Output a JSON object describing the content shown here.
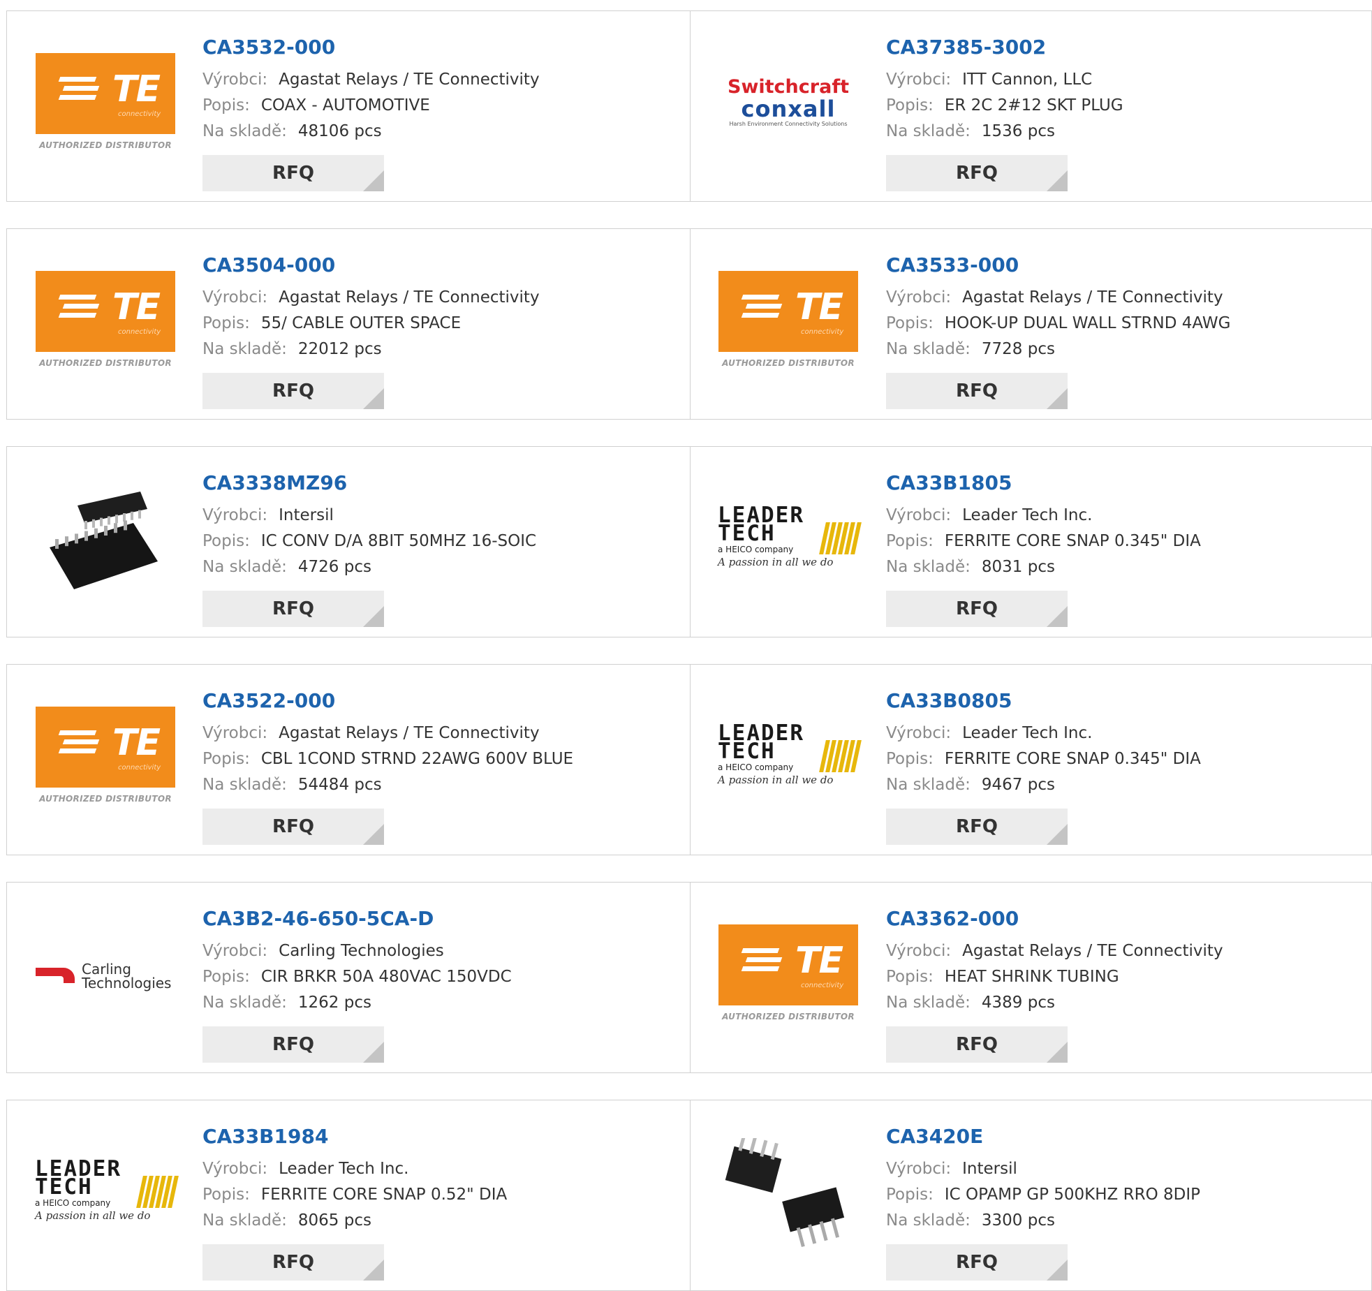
{
  "labels": {
    "manufacturer": "Výrobci:",
    "description": "Popis:",
    "stock": "Na skladě:",
    "rfq": "RFQ"
  },
  "logo_text": {
    "te": "TE",
    "te_sub": "connectivity",
    "te_auth": "AUTHORIZED DISTRIBUTOR",
    "switchcraft": "Switchcraft",
    "conxall": "conxall",
    "switch_tag": "Harsh Environment Connectivity Solutions",
    "leader": "LEADER",
    "tech": "TECH",
    "heico": "a HEICO company",
    "passion": "A passion in all we do",
    "carling1": "Carling",
    "carling2": "Technologies"
  },
  "products": [
    {
      "part": "CA3532-000",
      "manufacturer": "Agastat Relays / TE Connectivity",
      "description": "COAX - AUTOMOTIVE",
      "stock": "48106 pcs",
      "logo": "te"
    },
    {
      "part": "CA37385-3002",
      "manufacturer": "ITT Cannon, LLC",
      "description": "ER 2C 2#12 SKT PLUG",
      "stock": "1536 pcs",
      "logo": "switchcraft"
    },
    {
      "part": "CA3504-000",
      "manufacturer": "Agastat Relays / TE Connectivity",
      "description": "55/ CABLE OUTER SPACE",
      "stock": "22012 pcs",
      "logo": "te"
    },
    {
      "part": "CA3533-000",
      "manufacturer": "Agastat Relays / TE Connectivity",
      "description": "HOOK-UP DUAL WALL STRND 4AWG",
      "stock": "7728 pcs",
      "logo": "te"
    },
    {
      "part": "CA3338MZ96",
      "manufacturer": "Intersil",
      "description": "IC CONV D/A 8BIT 50MHZ 16-SOIC",
      "stock": "4726 pcs",
      "logo": "soic"
    },
    {
      "part": "CA33B1805",
      "manufacturer": "Leader Tech Inc.",
      "description": "FERRITE CORE SNAP 0.345\" DIA",
      "stock": "8031 pcs",
      "logo": "leader"
    },
    {
      "part": "CA3522-000",
      "manufacturer": "Agastat Relays / TE Connectivity",
      "description": "CBL 1COND STRND 22AWG 600V BLUE",
      "stock": "54484 pcs",
      "logo": "te"
    },
    {
      "part": "CA33B0805",
      "manufacturer": "Leader Tech Inc.",
      "description": "FERRITE CORE SNAP 0.345\" DIA",
      "stock": "9467 pcs",
      "logo": "leader"
    },
    {
      "part": "CA3B2-46-650-5CA-D",
      "manufacturer": "Carling Technologies",
      "description": "CIR BRKR 50A 480VAC 150VDC",
      "stock": "1262 pcs",
      "logo": "carling"
    },
    {
      "part": "CA3362-000",
      "manufacturer": "Agastat Relays / TE Connectivity",
      "description": "HEAT SHRINK TUBING",
      "stock": "4389 pcs",
      "logo": "te"
    },
    {
      "part": "CA33B1984",
      "manufacturer": "Leader Tech Inc.",
      "description": "FERRITE CORE SNAP 0.52\" DIA",
      "stock": "8065 pcs",
      "logo": "leader"
    },
    {
      "part": "CA3420E",
      "manufacturer": "Intersil",
      "description": "IC OPAMP GP 500KHZ RRO 8DIP",
      "stock": "3300 pcs",
      "logo": "dip"
    }
  ],
  "colors": {
    "link": "#1d63ad",
    "te_orange": "#f28c1b",
    "switchcraft_red": "#d8232a",
    "conxall_blue": "#1d4e9a",
    "leader_yellow": "#e7b70b",
    "carling_red": "#d8232a",
    "button_bg": "#ececec"
  }
}
